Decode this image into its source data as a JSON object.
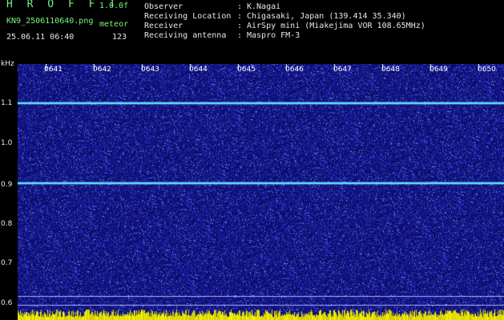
{
  "header": {
    "app_title": "H R O F F T",
    "version": "1.0.0f",
    "filename": "KN9_2506110640.png",
    "mode": "meteor",
    "datetime": "25.06.11 06:40",
    "count": "123"
  },
  "meta": [
    {
      "label": "Observer",
      "value": "K.Nagai"
    },
    {
      "label": "Receiving Location",
      "value": "Chigasaki, Japan (139.414 35.340)"
    },
    {
      "label": "Receiver",
      "value": "AirSpy mini (Miakejima VOR 108.65MHz)"
    },
    {
      "label": "Receiving antenna",
      "value": "Maspro FM-3"
    }
  ],
  "meta_sep": ":",
  "waterfall": {
    "y_unit": "kHz",
    "y_ticks": [
      "1.1",
      "1.0",
      "0.9",
      "0.8",
      "0.7",
      "0.6"
    ],
    "x_ticks": [
      "0641",
      "0642",
      "0643",
      "0644",
      "0645",
      "0646",
      "0647",
      "0648",
      "0649",
      "0650"
    ],
    "signal_lines_khz": [
      1.1,
      0.9
    ],
    "background_color": "#10107a",
    "signal_color": "#66e0ff",
    "baseline_color": "#f0f000"
  }
}
